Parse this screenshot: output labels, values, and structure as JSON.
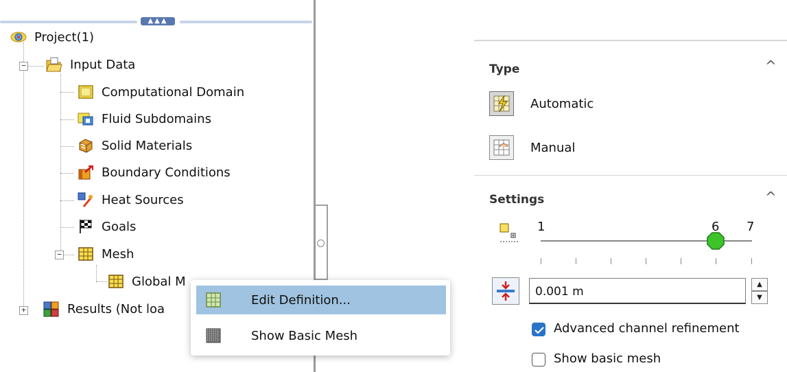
{
  "tree": {
    "project": "Project(1)",
    "input_data": "Input Data",
    "items": [
      "Computational Domain",
      "Fluid Subdomains",
      "Solid Materials",
      "Boundary Conditions",
      "Heat Sources",
      "Goals",
      "Mesh"
    ],
    "global_mesh": "Global M",
    "results": "Results (Not loa"
  },
  "splitter": {
    "dots": "▲▲▲"
  },
  "context_menu": {
    "edit_definition": "Edit Definition...",
    "show_basic_mesh": "Show Basic Mesh"
  },
  "type_section": {
    "title": "Type",
    "automatic": "Automatic",
    "manual": "Manual",
    "selected": "Automatic"
  },
  "settings_section": {
    "title": "Settings",
    "slider_min": "1",
    "slider_current": "6",
    "slider_max": "7",
    "slider_value": 6,
    "min_gap_value": "0.001 m",
    "advanced_channel_refinement_label": "Advanced channel refinement",
    "advanced_channel_refinement_checked": true,
    "show_basic_mesh_label": "Show basic mesh",
    "show_basic_mesh_checked": false
  },
  "colors": {
    "highlight": "#9fc3e0",
    "checkbox_accent": "#2a74c8",
    "slider_thumb": "#3ec42a"
  }
}
